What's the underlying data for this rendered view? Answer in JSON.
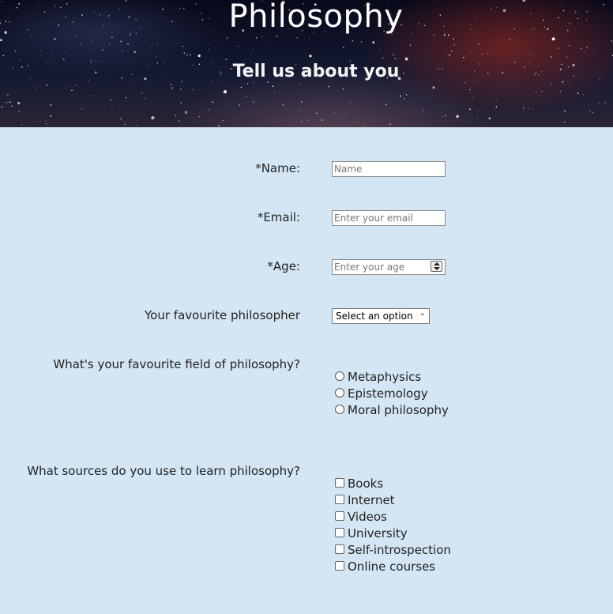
{
  "header": {
    "title": "Philosophy",
    "subtitle": "Tell us about you"
  },
  "form": {
    "name": {
      "label": "*Name:",
      "placeholder": "Name",
      "value": ""
    },
    "email": {
      "label": "*Email:",
      "placeholder": "Enter your email",
      "value": ""
    },
    "age": {
      "label": "*Age:",
      "placeholder": "Enter your age",
      "value": ""
    },
    "philosopher": {
      "label": "Your favourite philosopher",
      "selected": "Select an option"
    },
    "field": {
      "label": "What's your favourite field of philosophy?",
      "options": [
        {
          "label": " Metaphysics",
          "checked": false
        },
        {
          "label": "Epistemology",
          "checked": false
        },
        {
          "label": "Moral philosophy",
          "checked": false
        }
      ]
    },
    "sources": {
      "label": "What sources do you use to learn philosophy?",
      "options": [
        {
          "label": "Books",
          "checked": false
        },
        {
          "label": "Internet",
          "checked": false
        },
        {
          "label": "Videos",
          "checked": false
        },
        {
          "label": "University",
          "checked": false
        },
        {
          "label": "Self-introspection",
          "checked": false
        },
        {
          "label": "Online courses",
          "checked": false
        }
      ]
    }
  },
  "icons": {
    "select_arrow": "chevron-down-icon",
    "age_spinner": "spinner-arrows-icon"
  }
}
